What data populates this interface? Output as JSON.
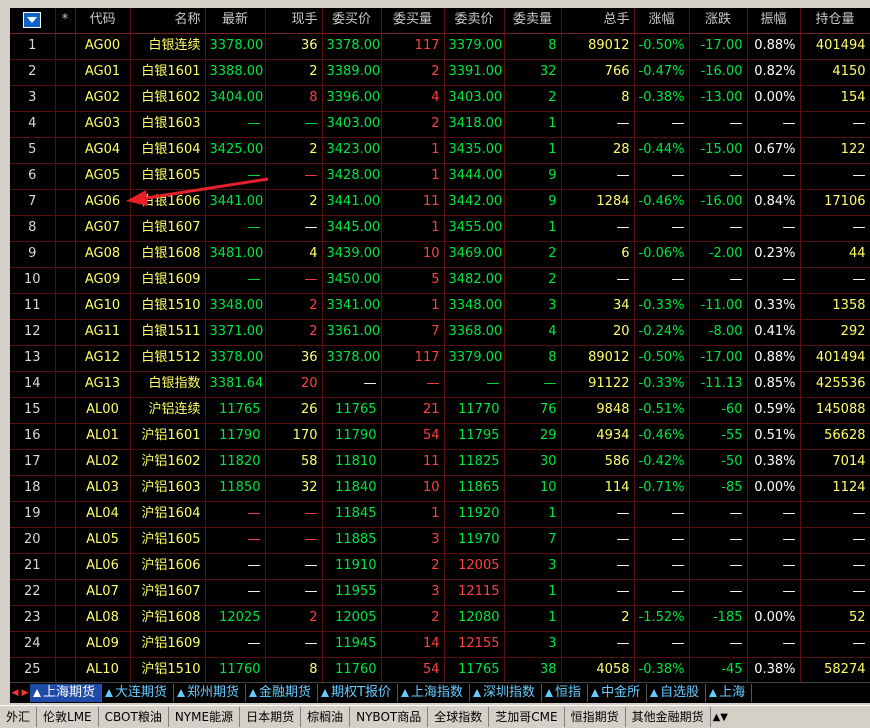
{
  "columns": [
    "*",
    "代码",
    "名称",
    "最新",
    "现手",
    "委买价",
    "委买量",
    "委卖价",
    "委卖量",
    "总手",
    "涨幅",
    "涨跌",
    "振幅",
    "持仓量"
  ],
  "rows": [
    {
      "idx": "1",
      "code": "AG00",
      "name": "白银连续",
      "last": "3378.00",
      "vol": "36",
      "bid": "3378.00",
      "bidq": "117",
      "ask": "3379.00",
      "askq": "8",
      "total": "89012",
      "pct": "-0.50%",
      "chg": "-17.00",
      "amp": "0.88%",
      "oi": "401494"
    },
    {
      "idx": "2",
      "code": "AG01",
      "name": "白银1601",
      "last": "3388.00",
      "vol": "2",
      "bid": "3389.00",
      "bidq": "2",
      "ask": "3391.00",
      "askq": "32",
      "total": "766",
      "pct": "-0.47%",
      "chg": "-16.00",
      "amp": "0.82%",
      "oi": "4150"
    },
    {
      "idx": "3",
      "code": "AG02",
      "name": "白银1602",
      "last": "3404.00",
      "vol": "8",
      "bid": "3396.00",
      "bidq": "4",
      "ask": "3403.00",
      "askq": "2",
      "total": "8",
      "pct": "-0.38%",
      "chg": "-13.00",
      "amp": "0.00%",
      "oi": "154"
    },
    {
      "idx": "4",
      "code": "AG03",
      "name": "白银1603",
      "last": "—",
      "vol": "—",
      "bid": "3403.00",
      "bidq": "2",
      "ask": "3418.00",
      "askq": "1",
      "total": "—",
      "pct": "—",
      "chg": "—",
      "amp": "—",
      "oi": "—"
    },
    {
      "idx": "5",
      "code": "AG04",
      "name": "白银1604",
      "last": "3425.00",
      "vol": "2",
      "bid": "3423.00",
      "bidq": "1",
      "ask": "3435.00",
      "askq": "1",
      "total": "28",
      "pct": "-0.44%",
      "chg": "-15.00",
      "amp": "0.67%",
      "oi": "122"
    },
    {
      "idx": "6",
      "code": "AG05",
      "name": "白银1605",
      "last": "—",
      "vol": "—",
      "bid": "3428.00",
      "bidq": "1",
      "ask": "3444.00",
      "askq": "9",
      "total": "—",
      "pct": "—",
      "chg": "—",
      "amp": "—",
      "oi": "—"
    },
    {
      "idx": "7",
      "code": "AG06",
      "name": "白银1606",
      "last": "3441.00",
      "vol": "2",
      "bid": "3441.00",
      "bidq": "11",
      "ask": "3442.00",
      "askq": "9",
      "total": "1284",
      "pct": "-0.46%",
      "chg": "-16.00",
      "amp": "0.84%",
      "oi": "17106"
    },
    {
      "idx": "8",
      "code": "AG07",
      "name": "白银1607",
      "last": "—",
      "vol": "—",
      "bid": "3445.00",
      "bidq": "1",
      "ask": "3455.00",
      "askq": "1",
      "total": "—",
      "pct": "—",
      "chg": "—",
      "amp": "—",
      "oi": "—"
    },
    {
      "idx": "9",
      "code": "AG08",
      "name": "白银1608",
      "last": "3481.00",
      "vol": "4",
      "bid": "3439.00",
      "bidq": "10",
      "ask": "3469.00",
      "askq": "2",
      "total": "6",
      "pct": "-0.06%",
      "chg": "-2.00",
      "amp": "0.23%",
      "oi": "44"
    },
    {
      "idx": "10",
      "code": "AG09",
      "name": "白银1609",
      "last": "—",
      "vol": "—",
      "bid": "3450.00",
      "bidq": "5",
      "ask": "3482.00",
      "askq": "2",
      "total": "—",
      "pct": "—",
      "chg": "—",
      "amp": "—",
      "oi": "—"
    },
    {
      "idx": "11",
      "code": "AG10",
      "name": "白银1510",
      "last": "3348.00",
      "vol": "2",
      "bid": "3341.00",
      "bidq": "1",
      "ask": "3348.00",
      "askq": "3",
      "total": "34",
      "pct": "-0.33%",
      "chg": "-11.00",
      "amp": "0.33%",
      "oi": "1358"
    },
    {
      "idx": "12",
      "code": "AG11",
      "name": "白银1511",
      "last": "3371.00",
      "vol": "2",
      "bid": "3361.00",
      "bidq": "7",
      "ask": "3368.00",
      "askq": "4",
      "total": "20",
      "pct": "-0.24%",
      "chg": "-8.00",
      "amp": "0.41%",
      "oi": "292"
    },
    {
      "idx": "13",
      "code": "AG12",
      "name": "白银1512",
      "last": "3378.00",
      "vol": "36",
      "bid": "3378.00",
      "bidq": "117",
      "ask": "3379.00",
      "askq": "8",
      "total": "89012",
      "pct": "-0.50%",
      "chg": "-17.00",
      "amp": "0.88%",
      "oi": "401494"
    },
    {
      "idx": "14",
      "code": "AG13",
      "name": "白银指数",
      "last": "3381.64",
      "vol": "20",
      "bid": "—",
      "bidq": "—",
      "ask": "—",
      "askq": "—",
      "total": "91122",
      "pct": "-0.33%",
      "chg": "-11.13",
      "amp": "0.85%",
      "oi": "425536"
    },
    {
      "idx": "15",
      "code": "AL00",
      "name": "沪铝连续",
      "last": "11765",
      "vol": "26",
      "bid": "11765",
      "bidq": "21",
      "ask": "11770",
      "askq": "76",
      "total": "9848",
      "pct": "-0.51%",
      "chg": "-60",
      "amp": "0.59%",
      "oi": "145088"
    },
    {
      "idx": "16",
      "code": "AL01",
      "name": "沪铝1601",
      "last": "11790",
      "vol": "170",
      "bid": "11790",
      "bidq": "54",
      "ask": "11795",
      "askq": "29",
      "total": "4934",
      "pct": "-0.46%",
      "chg": "-55",
      "amp": "0.51%",
      "oi": "56628"
    },
    {
      "idx": "17",
      "code": "AL02",
      "name": "沪铝1602",
      "last": "11820",
      "vol": "58",
      "bid": "11810",
      "bidq": "11",
      "ask": "11825",
      "askq": "30",
      "total": "586",
      "pct": "-0.42%",
      "chg": "-50",
      "amp": "0.38%",
      "oi": "7014"
    },
    {
      "idx": "18",
      "code": "AL03",
      "name": "沪铝1603",
      "last": "11850",
      "vol": "32",
      "bid": "11840",
      "bidq": "10",
      "ask": "11865",
      "askq": "10",
      "total": "114",
      "pct": "-0.71%",
      "chg": "-85",
      "amp": "0.00%",
      "oi": "1124"
    },
    {
      "idx": "19",
      "code": "AL04",
      "name": "沪铝1604",
      "last": "—",
      "vol": "—",
      "bid": "11845",
      "bidq": "1",
      "ask": "11920",
      "askq": "1",
      "total": "—",
      "pct": "—",
      "chg": "—",
      "amp": "—",
      "oi": "—"
    },
    {
      "idx": "20",
      "code": "AL05",
      "name": "沪铝1605",
      "last": "—",
      "vol": "—",
      "bid": "11885",
      "bidq": "3",
      "ask": "11970",
      "askq": "7",
      "total": "—",
      "pct": "—",
      "chg": "—",
      "amp": "—",
      "oi": "—"
    },
    {
      "idx": "21",
      "code": "AL06",
      "name": "沪铝1606",
      "last": "—",
      "vol": "—",
      "bid": "11910",
      "bidq": "2",
      "ask": "12005",
      "askq": "3",
      "total": "—",
      "pct": "—",
      "chg": "—",
      "amp": "—",
      "oi": "—"
    },
    {
      "idx": "22",
      "code": "AL07",
      "name": "沪铝1607",
      "last": "—",
      "vol": "—",
      "bid": "11955",
      "bidq": "3",
      "ask": "12115",
      "askq": "1",
      "total": "—",
      "pct": "—",
      "chg": "—",
      "amp": "—",
      "oi": "—"
    },
    {
      "idx": "23",
      "code": "AL08",
      "name": "沪铝1608",
      "last": "12025",
      "vol": "2",
      "bid": "12005",
      "bidq": "2",
      "ask": "12080",
      "askq": "1",
      "total": "2",
      "pct": "-1.52%",
      "chg": "-185",
      "amp": "0.00%",
      "oi": "52"
    },
    {
      "idx": "24",
      "code": "AL09",
      "name": "沪铝1609",
      "last": "—",
      "vol": "—",
      "bid": "11945",
      "bidq": "14",
      "ask": "12155",
      "askq": "3",
      "total": "—",
      "pct": "—",
      "chg": "—",
      "amp": "—",
      "oi": "—"
    },
    {
      "idx": "25",
      "code": "AL10",
      "name": "沪铝1510",
      "last": "11760",
      "vol": "8",
      "bid": "11760",
      "bidq": "54",
      "ask": "11765",
      "askq": "38",
      "total": "4058",
      "pct": "-0.38%",
      "chg": "-45",
      "amp": "0.38%",
      "oi": "58274"
    }
  ],
  "colors": {
    "last": [
      "dn",
      "dn",
      "dn",
      "dn",
      "dn",
      "dn",
      "dn",
      "dn",
      "dn",
      "dn",
      "dn",
      "dn",
      "dn",
      "dn",
      "dn",
      "dn",
      "dn",
      "dn",
      "up",
      "up",
      "eq",
      "eq",
      "dn",
      "eq",
      "dn"
    ],
    "vol": [
      "yl",
      "yl",
      "up",
      "dn",
      "yl",
      "up",
      "yl",
      "eq",
      "yl",
      "up",
      "up",
      "up",
      "yl",
      "up",
      "yl",
      "yl",
      "yl",
      "yl",
      "up",
      "up",
      "eq",
      "eq",
      "up",
      "eq",
      "yl"
    ],
    "bid": [
      "dn",
      "dn",
      "dn",
      "dn",
      "dn",
      "dn",
      "dn",
      "dn",
      "dn",
      "dn",
      "dn",
      "dn",
      "dn",
      "eq",
      "dn",
      "dn",
      "dn",
      "dn",
      "dn",
      "dn",
      "dn",
      "dn",
      "dn",
      "dn",
      "dn"
    ],
    "bidq": [
      "up",
      "up",
      "up",
      "up",
      "up",
      "up",
      "up",
      "up",
      "up",
      "up",
      "up",
      "up",
      "up",
      "up",
      "up",
      "up",
      "up",
      "up",
      "up",
      "up",
      "up",
      "up",
      "up",
      "up",
      "up"
    ],
    "ask": [
      "dn",
      "dn",
      "dn",
      "dn",
      "dn",
      "dn",
      "dn",
      "dn",
      "dn",
      "dn",
      "dn",
      "dn",
      "dn",
      "dn",
      "dn",
      "dn",
      "dn",
      "dn",
      "dn",
      "dn",
      "up",
      "up",
      "dn",
      "up",
      "dn"
    ],
    "askq": [
      "dn",
      "dn",
      "dn",
      "dn",
      "dn",
      "dn",
      "dn",
      "dn",
      "dn",
      "dn",
      "dn",
      "dn",
      "dn",
      "dn",
      "dn",
      "dn",
      "dn",
      "dn",
      "dn",
      "dn",
      "dn",
      "dn",
      "dn",
      "dn",
      "dn"
    ],
    "pct": [
      "dn",
      "dn",
      "dn",
      "eq",
      "dn",
      "eq",
      "dn",
      "eq",
      "dn",
      "eq",
      "dn",
      "dn",
      "dn",
      "dn",
      "dn",
      "dn",
      "dn",
      "dn",
      "eq",
      "eq",
      "eq",
      "eq",
      "dn",
      "eq",
      "dn"
    ],
    "chg": [
      "dn",
      "dn",
      "dn",
      "eq",
      "dn",
      "eq",
      "dn",
      "eq",
      "dn",
      "eq",
      "dn",
      "dn",
      "dn",
      "dn",
      "dn",
      "dn",
      "dn",
      "dn",
      "eq",
      "eq",
      "eq",
      "eq",
      "dn",
      "eq",
      "dn"
    ]
  },
  "tabs": [
    {
      "label": "上海期货",
      "active": true
    },
    {
      "label": "大连期货",
      "active": false
    },
    {
      "label": "郑州期货",
      "active": false
    },
    {
      "label": "金融期货",
      "active": false
    },
    {
      "label": "期权T报价",
      "active": false
    },
    {
      "label": "上海指数",
      "active": false
    },
    {
      "label": "深圳指数",
      "active": false
    },
    {
      "label": "恒指",
      "active": false
    },
    {
      "label": "中金所",
      "active": false
    },
    {
      "label": "自选股",
      "active": false
    },
    {
      "label": "上海",
      "active": false
    }
  ],
  "bottom_tabs": [
    "外汇",
    "伦敦LME",
    "CBOT粮油",
    "NYME能源",
    "日本期货",
    "棕榈油",
    "NYBOT商品",
    "全球指数",
    "芝加哥CME",
    "恒指期货",
    "其他金融期货"
  ],
  "bottom_more": "▲▼"
}
